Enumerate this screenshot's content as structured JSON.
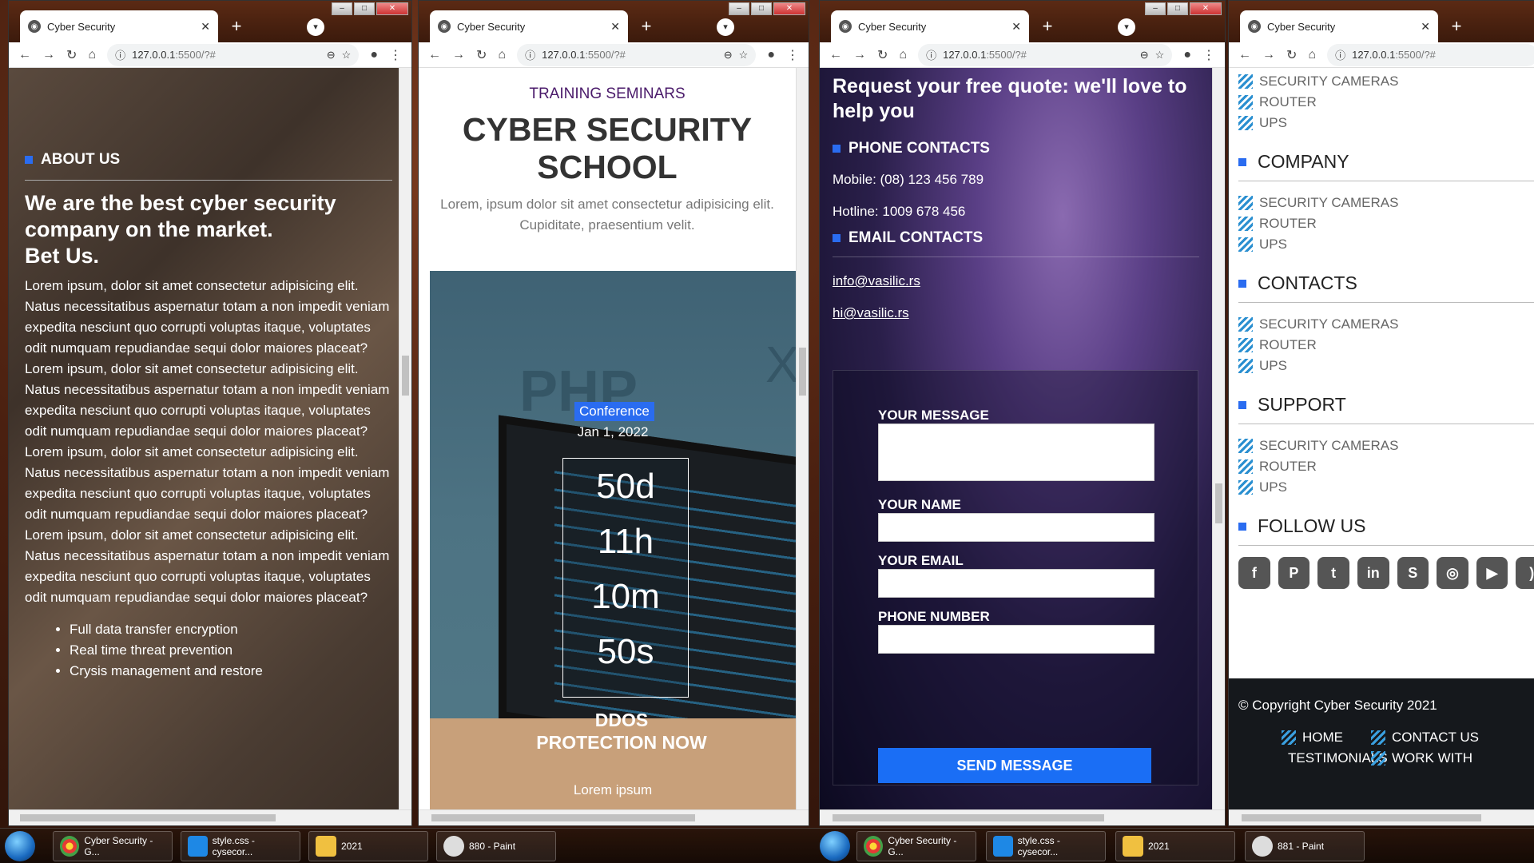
{
  "browser": {
    "tab_title": "Cyber Security",
    "url": "127.0.0.1",
    "url_rest": ":5500/?#"
  },
  "about": {
    "heading": "ABOUT US",
    "title_l1": "We are the best cyber security",
    "title_l2": "company on the market.",
    "title_l3": "Bet Us.",
    "paragraph": "Lorem ipsum, dolor sit amet consectetur adipisicing elit. Natus necessitatibus aspernatur totam a non impedit veniam expedita nesciunt quo corrupti voluptas itaque, voluptates odit numquam repudiandae sequi dolor maiores placeat? Lorem ipsum, dolor sit amet consectetur adipisicing elit. Natus necessitatibus aspernatur totam a non impedit veniam expedita nesciunt quo corrupti voluptas itaque, voluptates odit numquam repudiandae sequi dolor maiores placeat? Lorem ipsum, dolor sit amet consectetur adipisicing elit. Natus necessitatibus aspernatur totam a non impedit veniam expedita nesciunt quo corrupti voluptas itaque, voluptates odit numquam repudiandae sequi dolor maiores placeat? Lorem ipsum, dolor sit amet consectetur adipisicing elit. Natus necessitatibus aspernatur totam a non impedit veniam expedita nesciunt quo corrupti voluptas itaque, voluptates odit numquam repudiandae sequi dolor maiores placeat?",
    "bullets": [
      "Full data transfer encryption",
      "Real time threat prevention",
      "Crysis management and restore"
    ]
  },
  "seminar": {
    "kicker": "TRAINING SEMINARS",
    "title_l1": "CYBER SECURITY",
    "title_l2": "SCHOOL",
    "lead": "Lorem, ipsum dolor sit amet consectetur adipisicing elit. Cupiditate, praesentium velit.",
    "hero_word": "PHP",
    "hero_x": "X",
    "badge": "Conference",
    "date": "Jan 1, 2022",
    "countdown": [
      "50d",
      "11h",
      "10m",
      "50s"
    ],
    "cta": "DDOS PROTECTION NOW",
    "cta_sub": "Lorem ipsum"
  },
  "contact": {
    "request": "Request your free quote: we'll love to help you",
    "phone_heading": "PHONE CONTACTS",
    "mobile": "Mobile: (08) 123 456 789",
    "hotline": "Hotline: 1009 678 456",
    "email_heading": "EMAIL CONTACTS",
    "emails": [
      "info@vasilic.rs",
      "hi@vasilic.rs"
    ],
    "form": {
      "message_label": "YOUR MESSAGE",
      "name_label": "YOUR NAME",
      "email_label": "YOUR EMAIL",
      "phone_label": "PHONE NUMBER",
      "send": "SEND MESSAGE"
    }
  },
  "footer": {
    "top_items": [
      "SECURITY CAMERAS",
      "ROUTER",
      "UPS"
    ],
    "sections": [
      {
        "title": "COMPANY",
        "items": [
          "SECURITY CAMERAS",
          "ROUTER",
          "UPS"
        ]
      },
      {
        "title": "CONTACTS",
        "items": [
          "SECURITY CAMERAS",
          "ROUTER",
          "UPS"
        ]
      },
      {
        "title": "SUPPORT",
        "items": [
          "SECURITY CAMERAS",
          "ROUTER",
          "UPS"
        ]
      }
    ],
    "follow": "FOLLOW US",
    "social_icons": [
      "facebook-icon",
      "pinterest-icon",
      "twitter-icon",
      "linkedin-icon",
      "skype-icon",
      "instagram-icon",
      "youtube-icon",
      "rss-icon"
    ],
    "copyright": "© Copyright Cyber Security 2021",
    "nav": [
      "HOME",
      "CONTACT US",
      "TESTIMONIALS",
      "WORK WITH"
    ]
  },
  "taskbar1": {
    "chrome": "Cyber Security - G...",
    "vscode": "style.css - cysecor...",
    "folder": "2021",
    "paint": "880 - Paint"
  },
  "taskbar2": {
    "chrome": "Cyber Security - G...",
    "vscode": "style.css - cysecor...",
    "folder": "2021",
    "paint": "881 - Paint"
  }
}
